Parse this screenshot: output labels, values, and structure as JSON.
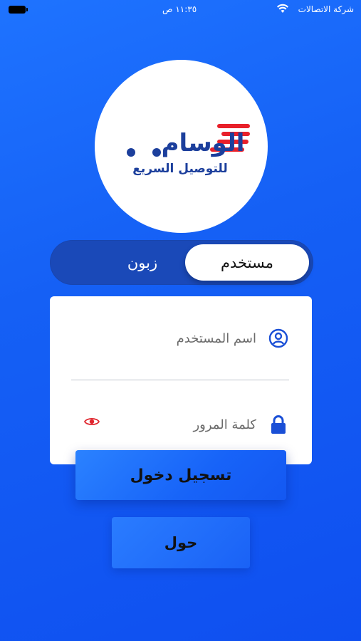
{
  "status_bar": {
    "carrier": "شركة الاتصالات",
    "time": "١١:٣٥ ص",
    "wifi_icon": "wifi-icon",
    "battery_icon": "battery-icon"
  },
  "logo": {
    "name": "الوسام",
    "tagline": "للتوصيل السريع",
    "accent_red": "#e8202a",
    "accent_blue": "#1c3f9c"
  },
  "segment": {
    "active_label": "مستخدم",
    "inactive_label": "زبون"
  },
  "form": {
    "username_placeholder": "اسم المستخدم",
    "username_icon": "user-circle-icon",
    "password_placeholder": "كلمة المرور",
    "password_icon": "lock-icon",
    "toggle_visibility_icon": "eye-icon"
  },
  "buttons": {
    "login": "تسجيل دخول",
    "about": "حول"
  },
  "colors": {
    "background": "#1560f5",
    "segment_bg": "#1a49b8",
    "icon_blue": "#1a4fd6",
    "eye_red": "#e0262e"
  }
}
